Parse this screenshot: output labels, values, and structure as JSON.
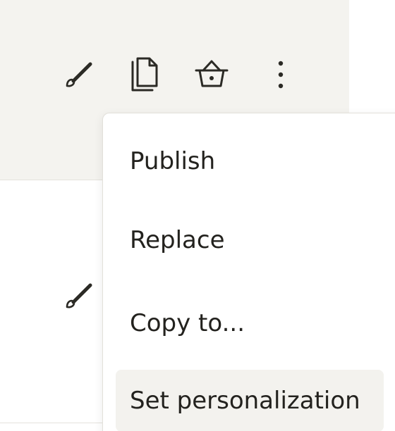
{
  "toolbar": {
    "icons": [
      "brush-icon",
      "copy-icon",
      "basket-icon",
      "more-vertical-icon"
    ]
  },
  "second_row": {
    "icons": [
      "brush-icon"
    ]
  },
  "menu": {
    "items": [
      {
        "label": "Publish"
      },
      {
        "label": "Replace"
      },
      {
        "label": "Copy to..."
      },
      {
        "label": "Set personalization",
        "hovered": true
      }
    ]
  },
  "colors": {
    "row_background": "#f4f3ef",
    "icon_color": "#2b2a25",
    "text_color": "#23221e",
    "hover_background": "#f3f2ee"
  }
}
